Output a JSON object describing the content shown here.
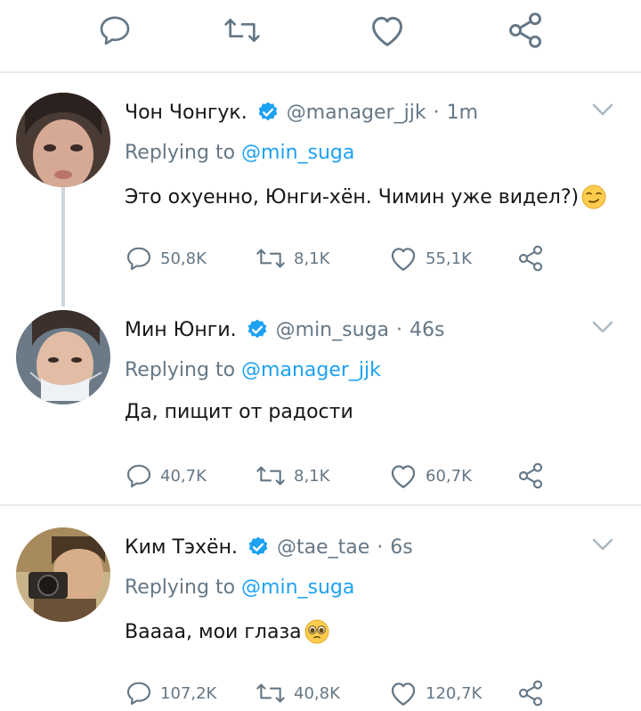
{
  "top_actions": {
    "reply_icon": "reply-icon",
    "retweet_icon": "retweet-icon",
    "like_icon": "heart-icon",
    "share_icon": "share-icon"
  },
  "colors": {
    "accent": "#1da1f2",
    "muted": "#657786",
    "text": "#14171a",
    "divider": "#e6ecf0"
  },
  "tweets": [
    {
      "name": "Чон Чонгук.",
      "handle": "@manager_jjk",
      "dot": "·",
      "time": "1m",
      "replying_prefix": "Replying to",
      "replying_to": "@min_suga",
      "text": "Это охуенно, Юнги-хён. Чимин уже видел?)",
      "emoji": "smirking-face",
      "replies": "50,8K",
      "retweets": "8,1K",
      "likes": "55,1K"
    },
    {
      "name": "Мин Юнги.",
      "handle": "@min_suga",
      "dot": "·",
      "time": "46s",
      "replying_prefix": "Replying to",
      "replying_to": "@manager_jjk",
      "text": "Да, пищит от радости",
      "replies": "40,7K",
      "retweets": "8,1K",
      "likes": "60,7K"
    },
    {
      "name": "Ким Тэхён.",
      "handle": "@tae_tae",
      "dot": "·",
      "time": "6s",
      "replying_prefix": "Replying to",
      "replying_to": "@min_suga",
      "text": "Вааaa, мои глаза",
      "emoji": "pleading-face",
      "replies": "107,2K",
      "retweets": "40,8K",
      "likes": "120,7K"
    }
  ]
}
